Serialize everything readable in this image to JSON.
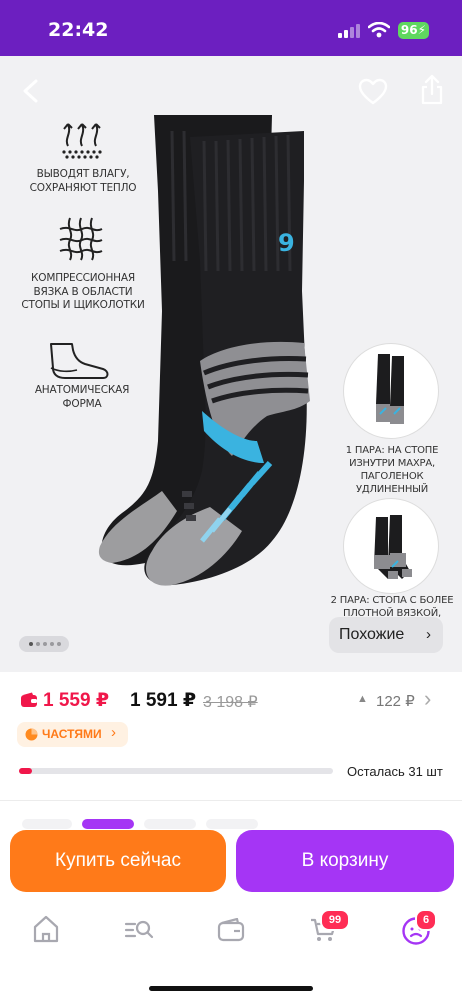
{
  "status_bar": {
    "time": "22:42",
    "battery": "96"
  },
  "gallery": {
    "features": [
      {
        "label": "ВЫВОДЯТ ВЛАГУ,\nСОХРАНЯЮТ ТЕПЛО",
        "icon": "moisture-wicking-icon"
      },
      {
        "label": "КОМПРЕССИОННАЯ\nВЯЗКА В ОБЛАСТИ\nСТОПЫ И ЩИКОЛОТКИ",
        "icon": "compression-knit-icon"
      },
      {
        "label": "АНАТОМИЧЕСКАЯ\nФОРМА",
        "icon": "foot-shape-icon"
      }
    ],
    "sock_logo": "9",
    "variants": [
      {
        "label": "1 ПАРА: НА СТОПЕ\nИЗНУТРИ МАХРА,\nПАГОЛЕНОК\nУДЛИНЕННЫЙ"
      },
      {
        "label": "2 ПАРА: СТОПА С БОЛЕЕ\nПЛОТНОЙ ВЯЗКОЙ,"
      }
    ],
    "similar_label": "Похожие",
    "page_indicator_count": 5,
    "active_page": 1
  },
  "price": {
    "card_price": "1 559 ₽",
    "price": "1 591 ₽",
    "old_price": "3 198 ₽",
    "price_change": "122 ₽",
    "installments_label": "ЧАСТЯМИ",
    "stock_text": "Осталась 31 шт",
    "stock_fraction": 0.04
  },
  "actions": {
    "buy_now": "Купить сейчас",
    "add_to_cart": "В корзину"
  },
  "nav": {
    "cart_badge": "99",
    "profile_badge": "6"
  },
  "colors": {
    "brand_purple": "#6c1fc0",
    "buy_orange": "#ff7a19",
    "cart_purple": "#a535f5",
    "price_red": "#f0174a",
    "accent_blue": "#3ab3e0"
  }
}
